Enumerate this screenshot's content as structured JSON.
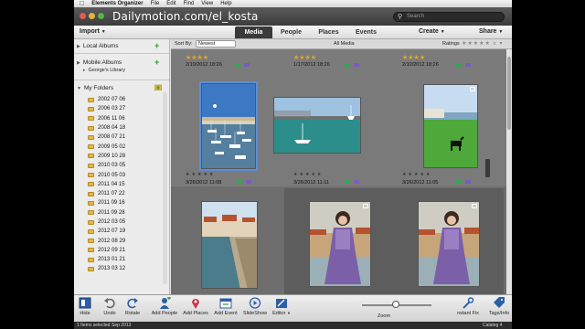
{
  "menubar": {
    "app_name": "Elements Organizer",
    "items": [
      "File",
      "Edit",
      "Find",
      "View",
      "Help"
    ]
  },
  "titlebar": {
    "watermark": "Dailymotion.com/el_kosta",
    "search_placeholder": "Search"
  },
  "toolbar": {
    "import": "Import",
    "tabs": [
      "Media",
      "People",
      "Places",
      "Events"
    ],
    "active_tab": "Media",
    "create": "Create",
    "share": "Share"
  },
  "sidebar": {
    "local_albums": "Local Albums",
    "mobile_albums": "Mobile Albums",
    "library": "George's Library",
    "my_folders": "My Folders",
    "folders": [
      "2002 07 06",
      "2006 03 27",
      "2006 11 06",
      "2008 04 18",
      "2008 07 21",
      "2009 05 02",
      "2009 10 28",
      "2010 03 05",
      "2010 05 03",
      "2011 04 15",
      "2011 07 22",
      "2011 09 16",
      "2011 09 28",
      "2012 03 05",
      "2012 07 19",
      "2012 08 29",
      "2012 09 21",
      "2013 01 21",
      "2013 03 12"
    ]
  },
  "sortbar": {
    "sort_by": "Sort By:",
    "sort_value": "Newest",
    "all_media": "All Media",
    "ratings": "Ratings"
  },
  "grid": {
    "row0": [
      {
        "stars": "★★★★",
        "date": "2/10/2012 18:26"
      },
      {
        "stars": "★★★★",
        "date": "1/17/2012 18:26"
      },
      {
        "stars": "★★★★",
        "date": "2/10/2012 18:26"
      }
    ],
    "row1": [
      {
        "date": "3/26/2012 11:08",
        "scene": "harbor-vertical"
      },
      {
        "date": "3/26/2012 11:11",
        "scene": "harbor-boat"
      },
      {
        "date": "3/26/2012 11:05",
        "scene": "horse-field"
      }
    ],
    "row2": [
      {
        "scene": "harbor-wall"
      },
      {
        "scene": "woman-purple"
      },
      {
        "scene": "woman-purple-2"
      }
    ]
  },
  "bottombar": {
    "tools": [
      "Hide",
      "Undo",
      "Rotate",
      "Add People",
      "Add Places",
      "Add Event",
      "SlideShow",
      "Editor"
    ],
    "zoom": "Zoom",
    "right_tools": [
      "nstant Fix",
      "Tags/Info"
    ]
  },
  "statusbar": {
    "left": "1 Items selected",
    "date": "Sep 2013",
    "right": "Catalog 4"
  },
  "colors": {
    "accent_selection": "#5b8fd8",
    "star": "#e7a524",
    "badge_green": "#2fa84f",
    "grid_bg": "#6d6d6d"
  }
}
